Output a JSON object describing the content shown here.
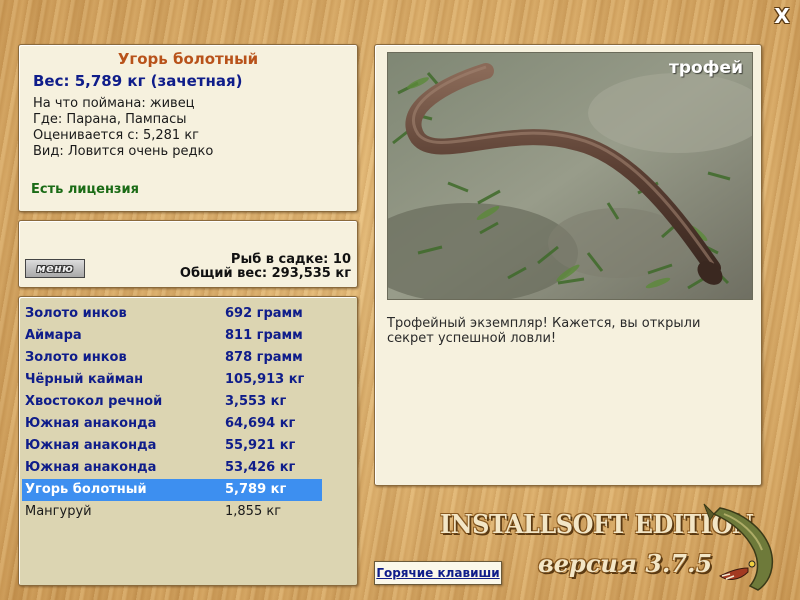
{
  "window": {
    "close_glyph": "X"
  },
  "fish": {
    "name": "Угорь болотный",
    "weight": "Вес: 5,789 кг (зачетная)",
    "bait": "На что поймана: живец",
    "location": "Где: Парана, Пампасы",
    "valued_from": "Оценивается с: 5,281 кг",
    "rarity": "Вид: Ловится очень редко",
    "license": "Есть лицензия"
  },
  "keepnet": {
    "menu_label": "меню",
    "count": "Рыб в садке: 10",
    "total": "Общий вес: 293,535 кг"
  },
  "catch_list": [
    {
      "name": "Золото инков",
      "weight": "692 грамм"
    },
    {
      "name": "Аймара",
      "weight": "811 грамм"
    },
    {
      "name": "Золото инков",
      "weight": "878 грамм"
    },
    {
      "name": "Чёрный кайман",
      "weight": "105,913 кг"
    },
    {
      "name": "Хвостокол речной",
      "weight": "3,553 кг"
    },
    {
      "name": "Южная анаконда",
      "weight": "64,694 кг"
    },
    {
      "name": "Южная анаконда",
      "weight": "55,921 кг"
    },
    {
      "name": "Южная анаконда",
      "weight": "53,426 кг"
    },
    {
      "name": "Угорь болотный",
      "weight": "5,789 кг"
    },
    {
      "name": "Мангуруй",
      "weight": "1,855 кг"
    }
  ],
  "selected_index": 8,
  "photo": {
    "badge": "трофей",
    "description": "Трофейный экземпляр! Кажется, вы открыли секрет успешной ловли!"
  },
  "footer": {
    "hotkeys": "Горячие клавиши",
    "edition": "INSTALLSOFT EDITION",
    "version": "версия 3.7.5"
  },
  "colors": {
    "title": "#b8521a",
    "weight": "#0f1d8a",
    "license": "#1a6b15",
    "selection": "#3d8ff0"
  },
  "icons": {
    "close": "close-icon",
    "mascot": "pike-fish-icon"
  }
}
